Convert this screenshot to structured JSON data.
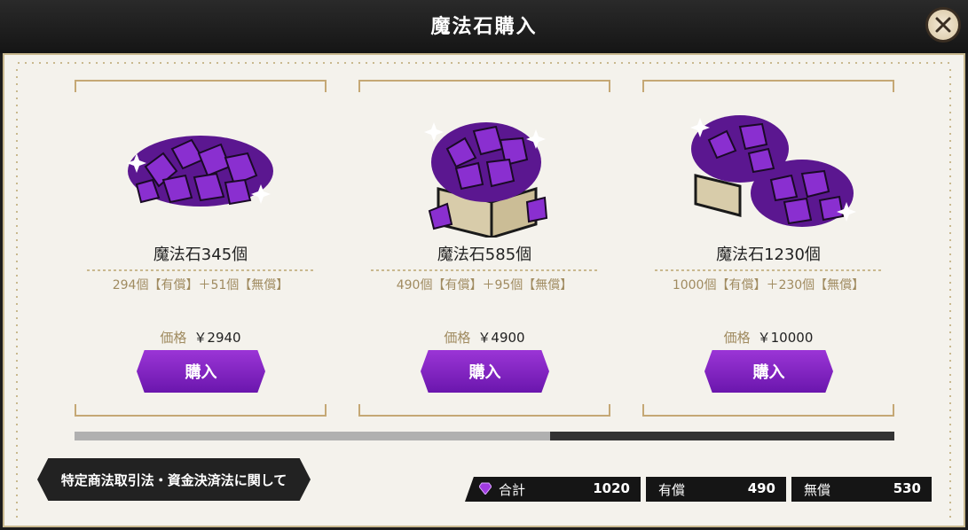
{
  "header": {
    "title": "魔法石購入"
  },
  "products": [
    {
      "name": "魔法石345個",
      "bonus": "294個【有償】＋51個【無償】",
      "price_label": "価格",
      "price": "￥2940",
      "buy_label": "購入"
    },
    {
      "name": "魔法石585個",
      "bonus": "490個【有償】＋95個【無償】",
      "price_label": "価格",
      "price": "￥4900",
      "buy_label": "購入"
    },
    {
      "name": "魔法石1230個",
      "bonus": "1000個【有償】＋230個【無償】",
      "price_label": "価格",
      "price": "￥10000",
      "buy_label": "購入"
    }
  ],
  "scroll": {
    "position_fraction": 0.58
  },
  "footer": {
    "legal_label": "特定商法取引法・資金決済法に関して",
    "total_label": "合計",
    "total_value": "1020",
    "paid_label": "有償",
    "paid_value": "490",
    "free_label": "無償",
    "free_value": "530"
  },
  "colors": {
    "accent": "#7a22be",
    "gold": "#c5a875"
  },
  "icons": {
    "close": "close-icon",
    "gem": "gem-icon"
  }
}
